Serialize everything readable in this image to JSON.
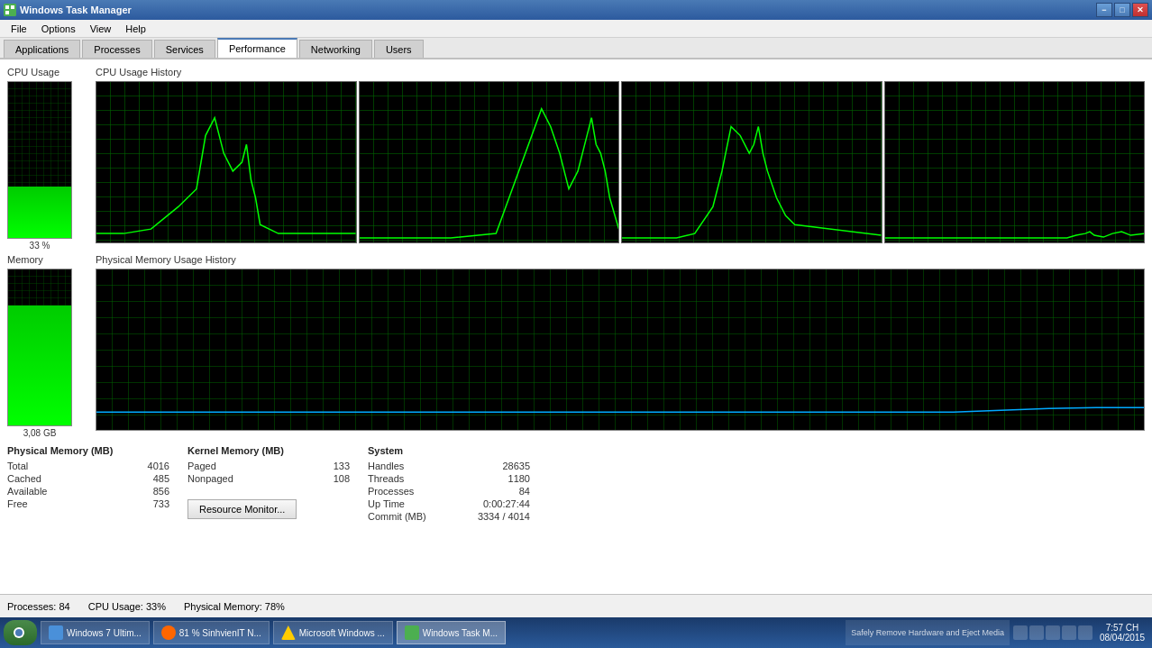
{
  "titleBar": {
    "title": "Windows Task Manager",
    "icon": "task-manager-icon",
    "controls": [
      "minimize",
      "restore",
      "close"
    ]
  },
  "menu": {
    "items": [
      "File",
      "Options",
      "View",
      "Help"
    ]
  },
  "tabs": {
    "items": [
      "Applications",
      "Processes",
      "Services",
      "Performance",
      "Networking",
      "Users"
    ],
    "active": "Performance"
  },
  "cpu": {
    "sectionTitle": "CPU Usage",
    "historyTitle": "CPU Usage History",
    "usagePercent": "33 %",
    "fillHeight": "33"
  },
  "memory": {
    "sectionTitle": "Memory",
    "historyTitle": "Physical Memory Usage History",
    "usageLabel": "3,08 GB",
    "fillPercent": "77"
  },
  "physicalMemory": {
    "groupTitle": "Physical Memory (MB)",
    "rows": [
      {
        "label": "Total",
        "value": "4016"
      },
      {
        "label": "Cached",
        "value": "485"
      },
      {
        "label": "Available",
        "value": "856"
      },
      {
        "label": "Free",
        "value": "733"
      }
    ]
  },
  "kernelMemory": {
    "groupTitle": "Kernel Memory (MB)",
    "rows": [
      {
        "label": "Paged",
        "value": "133"
      },
      {
        "label": "Nonpaged",
        "value": "108"
      }
    ]
  },
  "system": {
    "groupTitle": "System",
    "rows": [
      {
        "label": "Handles",
        "value": "28635"
      },
      {
        "label": "Threads",
        "value": "1180"
      },
      {
        "label": "Processes",
        "value": "84"
      },
      {
        "label": "Up Time",
        "value": "0:00:27:44"
      },
      {
        "label": "Commit (MB)",
        "value": "3334 / 4014"
      }
    ]
  },
  "resourceMonitorBtn": "Resource Monitor...",
  "statusBar": {
    "processes": "Processes: 84",
    "cpuUsage": "CPU Usage: 33%",
    "physicalMemory": "Physical Memory: 78%"
  },
  "taskbar": {
    "items": [
      {
        "label": "Windows 7 Ultim...",
        "icon": "windows-icon",
        "active": false
      },
      {
        "label": "81 % SinhvienIT N...",
        "icon": "browser-icon",
        "active": false
      },
      {
        "label": "Microsoft Windows ...",
        "icon": "warning-icon",
        "active": false
      },
      {
        "label": "Windows Task M...",
        "icon": "taskmgr-icon",
        "active": true
      }
    ],
    "trayText": "Safely Remove Hardware and Eject Media",
    "clock": {
      "time": "7:57 CH",
      "date": "08/04/2015"
    }
  }
}
